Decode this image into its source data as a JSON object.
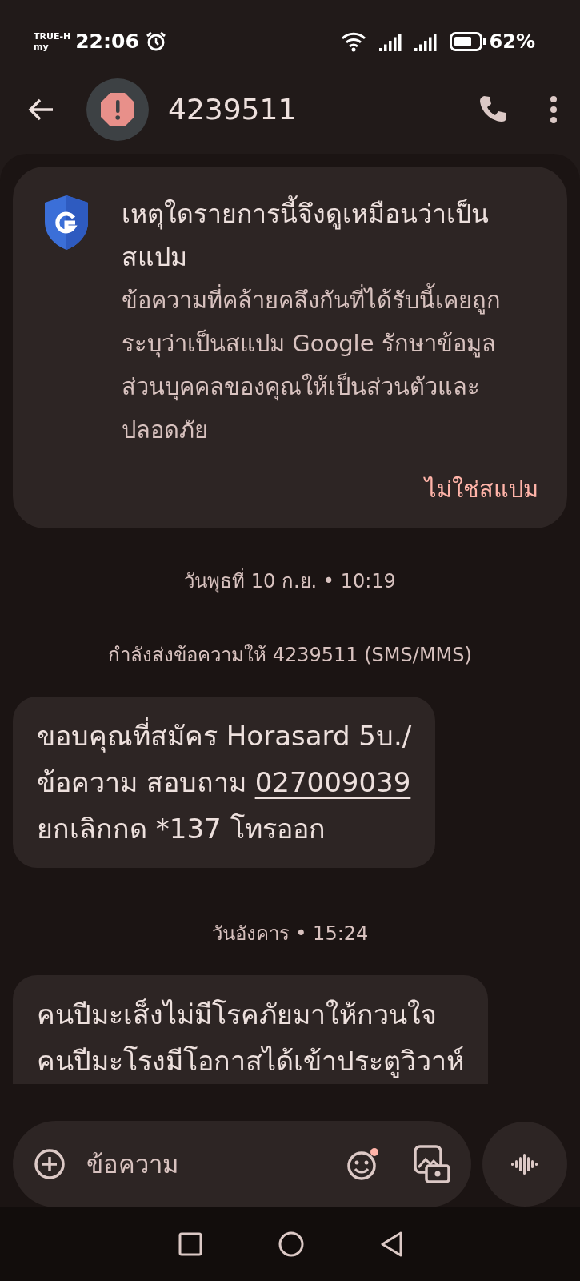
{
  "status_bar": {
    "carrier_top": "TRUE-H",
    "carrier_bottom": "my",
    "time": "22:06",
    "battery": "62%"
  },
  "header": {
    "title": "4239511"
  },
  "spam_card": {
    "title": "เหตุใดรายการนี้จึงดูเหมือนว่าเป็นสแปม",
    "body": "ข้อความที่คล้ายคลึงกันที่ได้รับนี้เคยถูกระบุว่าเป็นสแปม Google รักษาข้อมูลส่วนบุคคลของคุณให้เป็นส่วนตัวและปลอดภัย",
    "action": "ไม่ใช่สแปม"
  },
  "conversation": [
    {
      "kind": "date",
      "text": "วันพุธที่ 10 ก.ย. • 10:19"
    },
    {
      "kind": "notice",
      "text": "กำลังส่งข้อความให้ 4239511 (SMS/MMS)"
    },
    {
      "kind": "message",
      "parts": [
        {
          "text": "ขอบคุณที่สมัคร Horasard 5บ./\nข้อความ สอบถาม ",
          "link": false
        },
        {
          "text": "027009039",
          "link": true
        },
        {
          "text": "\nยกเลิกกด *137 โทรออก",
          "link": false
        }
      ]
    },
    {
      "kind": "date",
      "text": "วันอังคาร • 15:24"
    },
    {
      "kind": "message",
      "parts": [
        {
          "text": "คนปีมะเส็งไม่มีโรคภัยมาให้กวนใจ\nคนปีมะโรงมีโอกาสได้เข้าประตูวิวาห์",
          "link": false
        }
      ]
    }
  ],
  "composer": {
    "placeholder": "ข้อความ"
  }
}
